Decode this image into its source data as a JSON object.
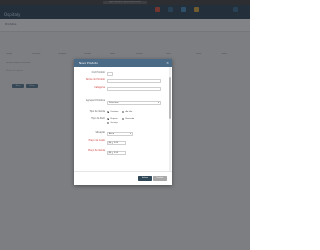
{
  "browser": {
    "url": "app.example.com/products/edit"
  },
  "app": {
    "logo": "Ospitaly"
  },
  "header_tabs": [
    {
      "label": "Estoque",
      "color": "#e0533c"
    },
    {
      "label": "Pedidos",
      "color": "#3a6e8e"
    },
    {
      "label": "Clientes",
      "color": "#4a8fc0"
    },
    {
      "label": "Fiscal",
      "color": "#d9a93a"
    },
    {
      "label": "Config",
      "color": "#3a6e8e"
    }
  ],
  "subbar": {
    "title": "Produtos"
  },
  "background": {
    "tabs": [
      "Codigo",
      "Descricao",
      "Categoria",
      "Unidade",
      "Marca",
      "Estoque",
      "Preco",
      "Status",
      "Acoes"
    ],
    "row_text": "Nenhum registro encontrado",
    "action_text": "Mostrar 10 registros",
    "buttons": [
      "Novo",
      "Filtrar"
    ]
  },
  "modal": {
    "title": "Novo Produto",
    "close_icon": "close-icon",
    "fields": {
      "codigo": {
        "label": "Cód Produto",
        "value": ""
      },
      "descricao": {
        "label": "Nome do Produto",
        "value": ""
      },
      "categoria": {
        "label": "Categoria",
        "value": ""
      },
      "unidade": {
        "label": "Agrupar Produtos",
        "value": "Selecione"
      },
      "tipo": {
        "label": "Tipo de Venda",
        "options": [
          "Unitario",
          "Ao kilo"
        ],
        "selected": 0
      },
      "origem": {
        "label": "Tipo de Item",
        "options": [
          "Próprio",
          "Revenda",
          "Serviço"
        ],
        "selected": 0
      },
      "situacao": {
        "label": "Situação",
        "value": "Ativo"
      },
      "preco_custo": {
        "label": "Preço de Custo",
        "unit": "R$",
        "value": "0,00"
      },
      "preco_venda": {
        "label": "Preço de Venda",
        "unit": "R$",
        "value": "0,00"
      }
    },
    "buttons": {
      "save": "Salvar",
      "cancel": "Fechar"
    }
  }
}
